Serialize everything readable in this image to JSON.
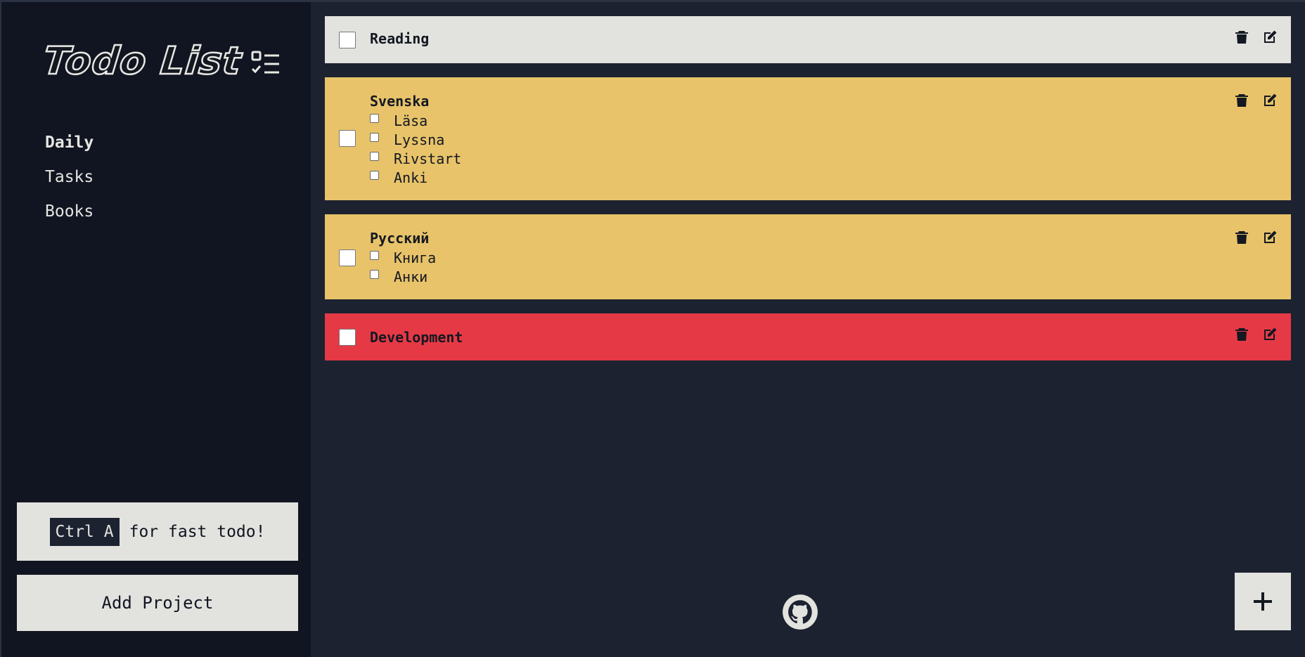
{
  "app": {
    "logo_text": "Todo List"
  },
  "sidebar": {
    "nav": [
      {
        "label": "Daily",
        "active": true
      },
      {
        "label": "Tasks",
        "active": false
      },
      {
        "label": "Books",
        "active": false
      }
    ],
    "hint": {
      "key": "Ctrl A",
      "text": "for fast todo!"
    },
    "add_project_label": "Add Project"
  },
  "todos": [
    {
      "title": "Reading",
      "color": "#e2e2df",
      "checked": false,
      "subtasks": []
    },
    {
      "title": "Svenska",
      "color": "#e8c36a",
      "checked": false,
      "subtasks": [
        {
          "label": "Läsa",
          "checked": false
        },
        {
          "label": "Lyssna",
          "checked": false
        },
        {
          "label": "Rivstart",
          "checked": false
        },
        {
          "label": "Anki",
          "checked": false
        }
      ]
    },
    {
      "title": "Русский",
      "color": "#e8c36a",
      "checked": false,
      "subtasks": [
        {
          "label": "Книга",
          "checked": false
        },
        {
          "label": "Анки",
          "checked": false
        }
      ]
    },
    {
      "title": "Development",
      "color": "#e63946",
      "checked": false,
      "subtasks": []
    }
  ],
  "icons": {
    "delete": "trash-icon",
    "edit": "edit-icon",
    "logo": "checklist-icon",
    "footer": "github-icon",
    "add": "plus-icon"
  },
  "colors": {
    "sidebar_bg": "#111521",
    "main_bg": "#1c2230",
    "light": "#e2e2df",
    "yellow": "#e8c36a",
    "red": "#e63946"
  }
}
